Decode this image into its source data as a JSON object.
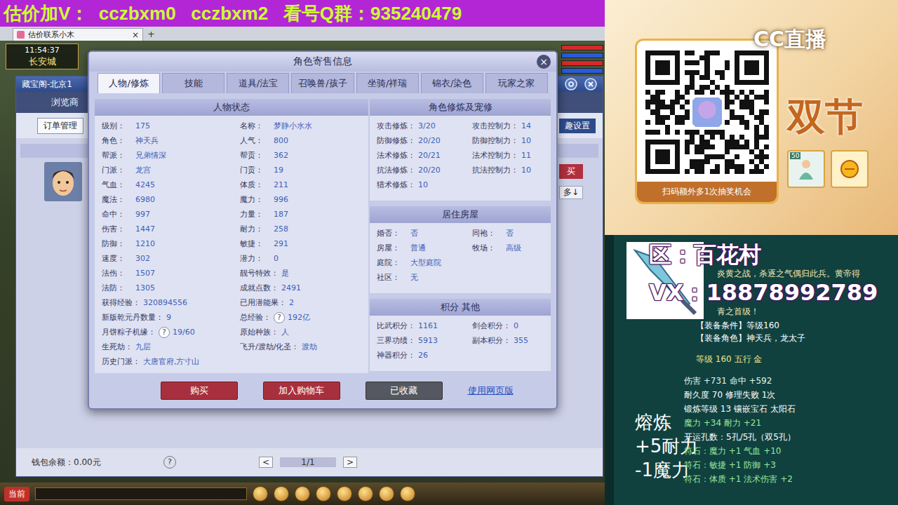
{
  "banner": {
    "text": "估价加V：  cczbxm0   cczbxm2   看号Q群：935240479"
  },
  "browser": {
    "tab": "估价联系小木",
    "close": "×",
    "add": "+"
  },
  "hud": {
    "time": "11:54:37",
    "location": "长安城"
  },
  "market": {
    "title": "藏宝阁-北京1",
    "nav": "浏览商",
    "order_button": "订单管理",
    "settings": "趣设置",
    "buy": "买",
    "more": "多↓",
    "wallet": "钱包余额：0.00元",
    "help": "?",
    "pager": {
      "prev": "<",
      "page": "1/1",
      "next": ">"
    }
  },
  "taskbar": {
    "current": "当前"
  },
  "dialog": {
    "title": "角色寄售信息",
    "close": "×",
    "tabs": [
      {
        "label": "人物/修炼",
        "selected": true
      },
      {
        "label": "技能",
        "selected": false
      },
      {
        "label": "道具/法宝",
        "selected": false
      },
      {
        "label": "召唤兽/孩子",
        "selected": false
      },
      {
        "label": "坐骑/祥瑞",
        "selected": false
      },
      {
        "label": "锦衣/染色",
        "selected": false
      },
      {
        "label": "玩家之家",
        "selected": false
      }
    ],
    "status": {
      "title": "人物状态",
      "rows": [
        [
          {
            "label": "级别：",
            "value": "175"
          },
          {
            "label": "名称：",
            "value": "梦静小水水"
          }
        ],
        [
          {
            "label": "角色：",
            "value": "神天兵"
          },
          {
            "label": "人气：",
            "value": "800"
          }
        ],
        [
          {
            "label": "帮派：",
            "value": "兄弟情深"
          },
          {
            "label": "帮贡：",
            "value": "362"
          }
        ],
        [
          {
            "label": "门派：",
            "value": "龙宫"
          },
          {
            "label": "门贡：",
            "value": "19"
          }
        ],
        [
          {
            "label": "气血：",
            "value": "4245"
          },
          {
            "label": "体质：",
            "value": "211"
          }
        ],
        [
          {
            "label": "魔法：",
            "value": "6980"
          },
          {
            "label": "魔力：",
            "value": "996"
          }
        ],
        [
          {
            "label": "命中：",
            "value": "997"
          },
          {
            "label": "力量：",
            "value": "187"
          }
        ],
        [
          {
            "label": "伤害：",
            "value": "1447"
          },
          {
            "label": "耐力：",
            "value": "258"
          }
        ],
        [
          {
            "label": "防御：",
            "value": "1210"
          },
          {
            "label": "敏捷：",
            "value": "291"
          }
        ],
        [
          {
            "label": "速度：",
            "value": "302"
          },
          {
            "label": "潜力：",
            "value": "0"
          }
        ],
        [
          {
            "label": "法伤：",
            "value": "1507"
          },
          {
            "label": "靓号特效：",
            "value": "是"
          }
        ],
        [
          {
            "label": "法防：",
            "value": "1305"
          },
          {
            "label": "成就点数：",
            "value": "2491"
          }
        ],
        [
          {
            "label": "获得经验：",
            "value": "320894556"
          },
          {
            "label": "已用潜能果：",
            "value": "2"
          }
        ],
        [
          {
            "label": "新版乾元丹数量：",
            "value": "9"
          },
          {
            "label": "总经验：",
            "help": "?",
            "value": "192亿"
          }
        ],
        [
          {
            "label": "月饼粽子机缘：",
            "help": "?",
            "value": "19/60"
          },
          {
            "label": "原始种族：",
            "value": "人"
          }
        ],
        [
          {
            "label": "生死劫：",
            "value": "九层"
          },
          {
            "label": "飞升/渡劫/化圣：",
            "value": "渡劫"
          }
        ],
        [
          {
            "label": "历史门派：",
            "value": "大唐官府,方寸山"
          }
        ]
      ]
    },
    "side_sections": [
      {
        "title": "角色修炼及宠修",
        "rows": [
          [
            {
              "label": "攻击修炼：",
              "value": "3/20"
            },
            {
              "label": "攻击控制力：",
              "value": "14"
            }
          ],
          [
            {
              "label": "防御修炼：",
              "value": "20/20"
            },
            {
              "label": "防御控制力：",
              "value": "10"
            }
          ],
          [
            {
              "label": "法术修炼：",
              "value": "20/21"
            },
            {
              "label": "法术控制力：",
              "value": "11"
            }
          ],
          [
            {
              "label": "抗法修炼：",
              "value": "20/20"
            },
            {
              "label": "抗法控制力：",
              "value": "10"
            }
          ],
          [
            {
              "label": "猎术修炼：",
              "value": "10"
            }
          ]
        ]
      },
      {
        "title": "居住房屋",
        "rows": [
          [
            {
              "label": "婚否：",
              "value": "否"
            },
            {
              "label": "同袍：",
              "value": "否"
            }
          ],
          [
            {
              "label": "房屋：",
              "value": "普通"
            },
            {
              "label": "牧场：",
              "value": "高级"
            }
          ],
          [
            {
              "label": "庭院：",
              "value": "大型庭院"
            }
          ],
          [
            {
              "label": "社区：",
              "value": "无"
            }
          ]
        ]
      },
      {
        "title": "积分 其他",
        "rows": [
          [
            {
              "label": "比武积分：",
              "value": "1161"
            },
            {
              "label": "剑会积分：",
              "value": "0"
            }
          ],
          [
            {
              "label": "三界功绩：",
              "value": "5913"
            },
            {
              "label": "副本积分：",
              "value": "355"
            }
          ],
          [
            {
              "label": "神器积分：",
              "value": "26"
            }
          ]
        ]
      }
    ],
    "buttons": [
      {
        "label": "购买",
        "kind": "danger"
      },
      {
        "label": "加入购物车",
        "kind": "danger"
      },
      {
        "label": "已收藏",
        "kind": "muted"
      }
    ],
    "link": "使用网页版"
  },
  "promo": {
    "logo": "CC直播",
    "headline": "双节",
    "badge": "50",
    "caption": "扫码额外多1次抽奖机会"
  },
  "item_card": {
    "region": "区：百花村",
    "contact": "VX：18878992789",
    "lore": [
      "炎黄之战，杀逐之气偶归此兵。黄帝得",
      "青之首级！"
    ],
    "requirements": [
      "【装备条件】等级160",
      "【装备角色】神天兵，龙太子"
    ],
    "grade": "等级 160 五行 金",
    "stats": [
      {
        "text": "伤害 +731 命中 +592",
        "color": "#e6f5e6"
      },
      {
        "text": "耐久度 70 修理失败 1次",
        "color": "#ffffff"
      },
      {
        "text": "锻炼等级 13 镶嵌宝石 太阳石",
        "color": "#ffffff"
      },
      {
        "text": "魔力 +34 耐力 +21",
        "color": "#9be89b"
      },
      {
        "text": "开运孔数：5孔/5孔（双5孔）",
        "color": "#ffffff"
      },
      {
        "text": "符石：魔力 +1 气血 +10",
        "color": "#9be89b"
      },
      {
        "text": "符石：敏捷 +1 防御 +3",
        "color": "#9be89b"
      },
      {
        "text": "符石：体质 +1 法术伤害 +2",
        "color": "#9be89b"
      }
    ],
    "smelt": {
      "title": "熔炼",
      "lines": [
        "+5耐力",
        "-1魔力"
      ]
    }
  }
}
